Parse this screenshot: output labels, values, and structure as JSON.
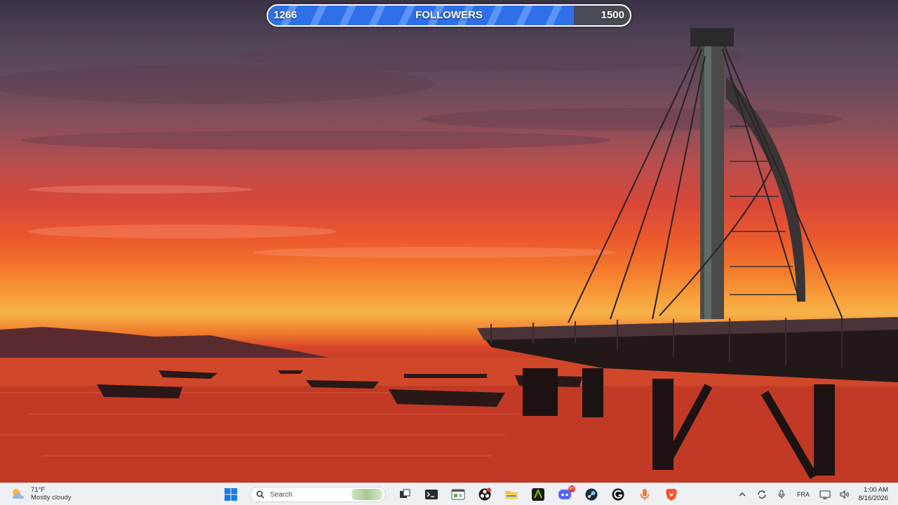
{
  "overlay": {
    "followers_current": "1266",
    "followers_label": "FOLLOWERS",
    "followers_goal": "1500",
    "progress_fraction": 0.844,
    "fill_color": "#2f6fe8"
  },
  "taskbar": {
    "weather": {
      "temp": "71°F",
      "condition": "Mostly cloudy",
      "icon": "partly-cloudy-icon"
    },
    "start_icon": "windows-logo-icon",
    "search": {
      "placeholder": "Search"
    },
    "apps": [
      {
        "name": "task-view",
        "icon": "task-view-icon"
      },
      {
        "name": "terminal",
        "icon": "terminal-icon"
      },
      {
        "name": "dev-app",
        "icon": "window-app-icon"
      },
      {
        "name": "obs-studio",
        "icon": "obs-icon"
      },
      {
        "name": "file-explorer",
        "icon": "folder-icon"
      },
      {
        "name": "nvidia-app",
        "icon": "nvidia-icon"
      },
      {
        "name": "discord",
        "icon": "discord-icon",
        "badge": "9+"
      },
      {
        "name": "steam",
        "icon": "steam-icon"
      },
      {
        "name": "g-hub",
        "icon": "logitech-icon"
      },
      {
        "name": "voice-app",
        "icon": "microphone-app-icon"
      },
      {
        "name": "brave-browser",
        "icon": "brave-icon"
      }
    ],
    "tray": {
      "language": "FRA",
      "time": "1:00 AM",
      "date": "8/16/2026"
    }
  },
  "colors": {
    "taskbar_bg": "#eef0f3",
    "accent": "#2f6fe8"
  }
}
